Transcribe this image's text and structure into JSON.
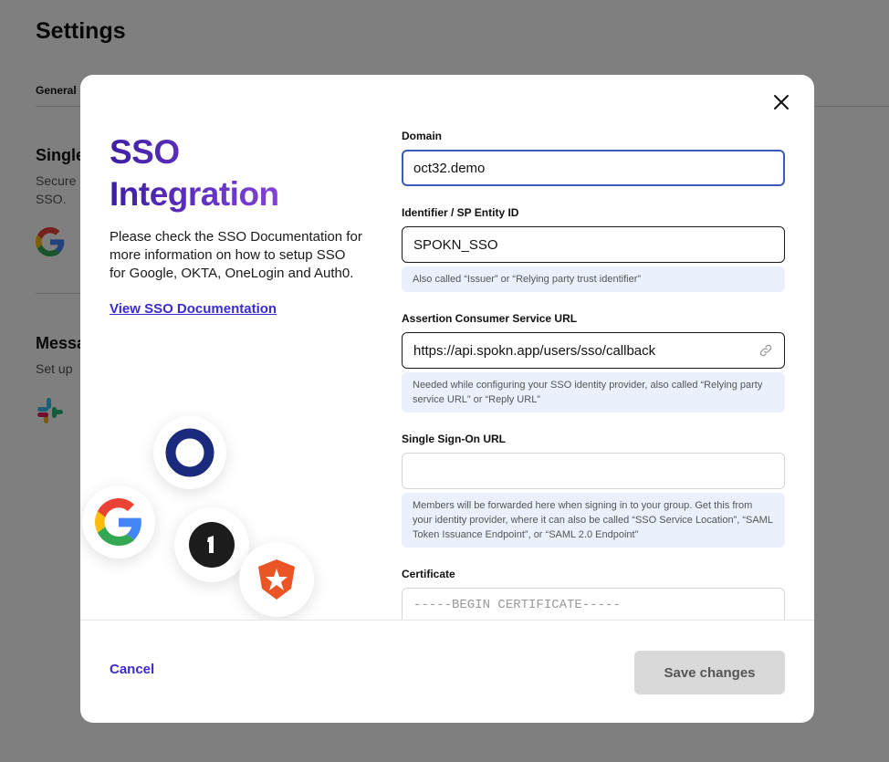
{
  "background": {
    "page_title": "Settings",
    "tab_general": "General",
    "single_sign_on_title_fragment": "Single",
    "single_sign_on_text_fragment_1": "Secure",
    "single_sign_on_text_fragment_2": "SSO.",
    "messaging_title_fragment": "Messa",
    "messaging_text_fragment": "Set up"
  },
  "modal": {
    "title_line_1": "SSO",
    "title_line_2": "Integration",
    "description": "Please check the SSO Documentation for more information on how to setup SSO for Google, OKTA, OneLogin and Auth0.",
    "doc_link": "View SSO Documentation",
    "fields": {
      "domain": {
        "label": "Domain",
        "value": "oct32.demo"
      },
      "entity_id": {
        "label": "Identifier / SP Entity ID",
        "value": "SPOKN_SSO",
        "hint": "Also called “Issuer” or “Relying party trust identifier”"
      },
      "acs_url": {
        "label": "Assertion Consumer Service URL",
        "value": "https://api.spokn.app/users/sso/callback",
        "hint": "Needed while configuring your SSO identity provider, also called “Relying party service URL” or “Reply URL”"
      },
      "sso_url": {
        "label": "Single Sign-On URL",
        "value": "",
        "hint": "Members will be forwarded here when signing in to your group. Get this from your identity provider, where it can also be called “SSO Service Location”, “SAML Token Issuance Endpoint”, or “SAML 2.0 Endpoint”"
      },
      "certificate": {
        "label": "Certificate",
        "placeholder": "-----BEGIN CERTIFICATE-----"
      }
    },
    "footer": {
      "cancel": "Cancel",
      "save": "Save changes"
    }
  },
  "colors": {
    "accent": "#3a2bd0",
    "hint_bg": "#eaf1fd",
    "focus_border": "#3c5ab8"
  },
  "icons": [
    "close-icon",
    "link-icon",
    "google-logo",
    "okta-logo",
    "onelogin-logo",
    "auth0-logo",
    "slack-logo"
  ]
}
